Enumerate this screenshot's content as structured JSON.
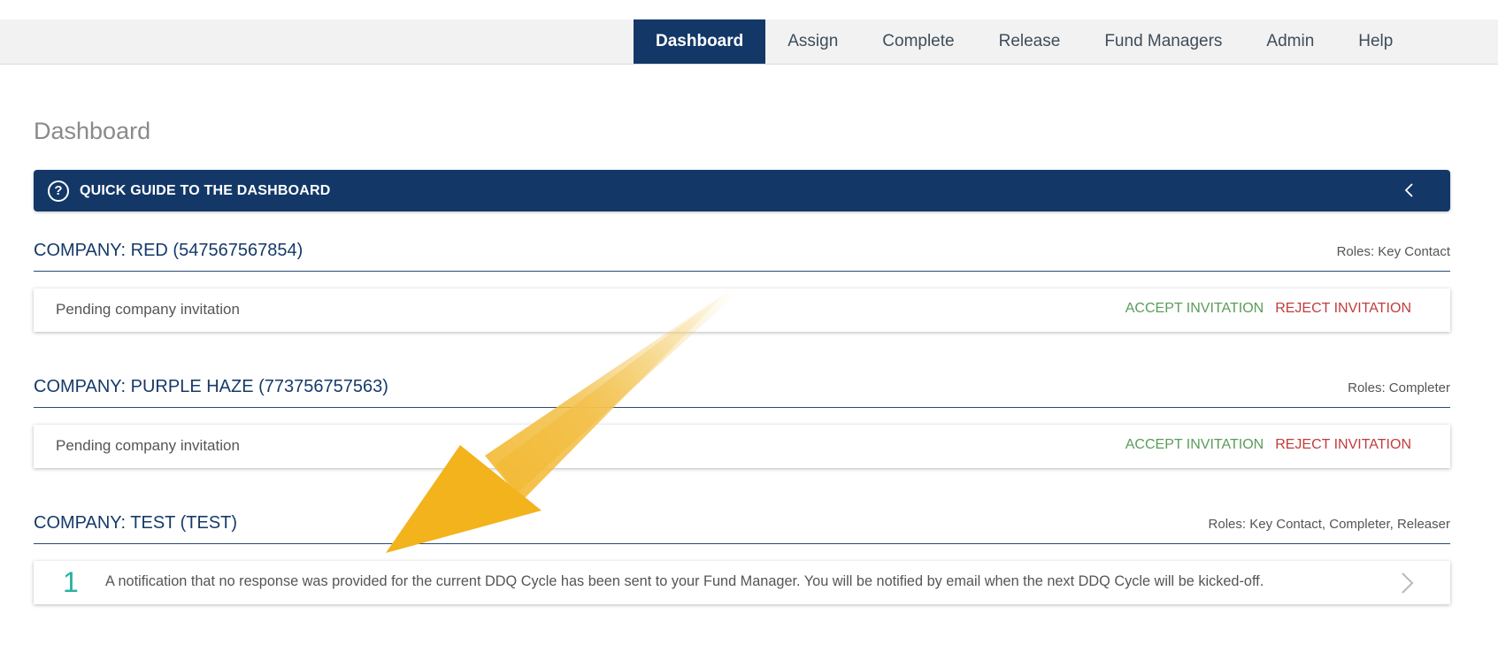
{
  "nav": {
    "items": [
      {
        "label": "Dashboard",
        "active": true
      },
      {
        "label": "Assign"
      },
      {
        "label": "Complete"
      },
      {
        "label": "Release"
      },
      {
        "label": "Fund Managers"
      },
      {
        "label": "Admin"
      },
      {
        "label": "Help"
      }
    ]
  },
  "page_title": "Dashboard",
  "quick_guide": {
    "icon": "question-circle-icon",
    "label": "QUICK GUIDE TO THE DASHBOARD"
  },
  "companies": [
    {
      "name": "COMPANY: RED (547567567854)",
      "roles": "Roles: Key Contact",
      "status": "Pending company invitation",
      "accept_label": "ACCEPT INVITATION",
      "reject_label": "REJECT INVITATION"
    },
    {
      "name": "COMPANY: PURPLE HAZE (773756757563)",
      "roles": "Roles: Completer",
      "status": "Pending company invitation",
      "accept_label": "ACCEPT INVITATION",
      "reject_label": "REJECT INVITATION"
    },
    {
      "name": "COMPANY: TEST (TEST)",
      "roles": "Roles: Key Contact, Completer, Releaser",
      "notification": {
        "count": "1",
        "text": "A notification that no response was provided for the current DDQ Cycle has been sent to your Fund Manager. You will be notified by email when the next DDQ Cycle will be kicked-off."
      }
    }
  ],
  "colors": {
    "primary": "#133868",
    "accept": "#5a9c5a",
    "reject": "#c23c3c",
    "count": "#27b1a2",
    "arrow": "#f2b31c"
  }
}
